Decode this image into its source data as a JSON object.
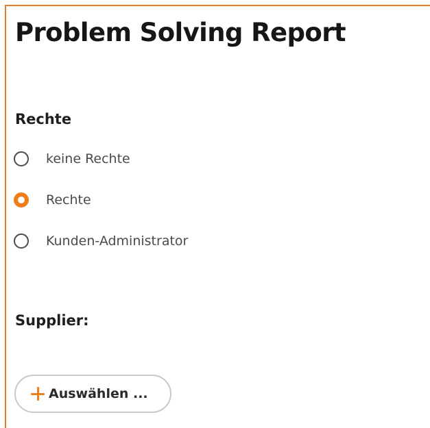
{
  "page": {
    "title": "Problem Solving Report"
  },
  "rights": {
    "label": "Rechte",
    "options": [
      {
        "label": "keine Rechte",
        "selected": false
      },
      {
        "label": "Rechte",
        "selected": true
      },
      {
        "label": "Kunden-Administrator",
        "selected": false
      }
    ]
  },
  "supplier": {
    "label": "Supplier:",
    "select_button_label": "Auswählen ...",
    "select_button_icon": "plus-icon"
  },
  "colors": {
    "accent": "#ef7d1a",
    "frame_border": "#e07d2a"
  }
}
